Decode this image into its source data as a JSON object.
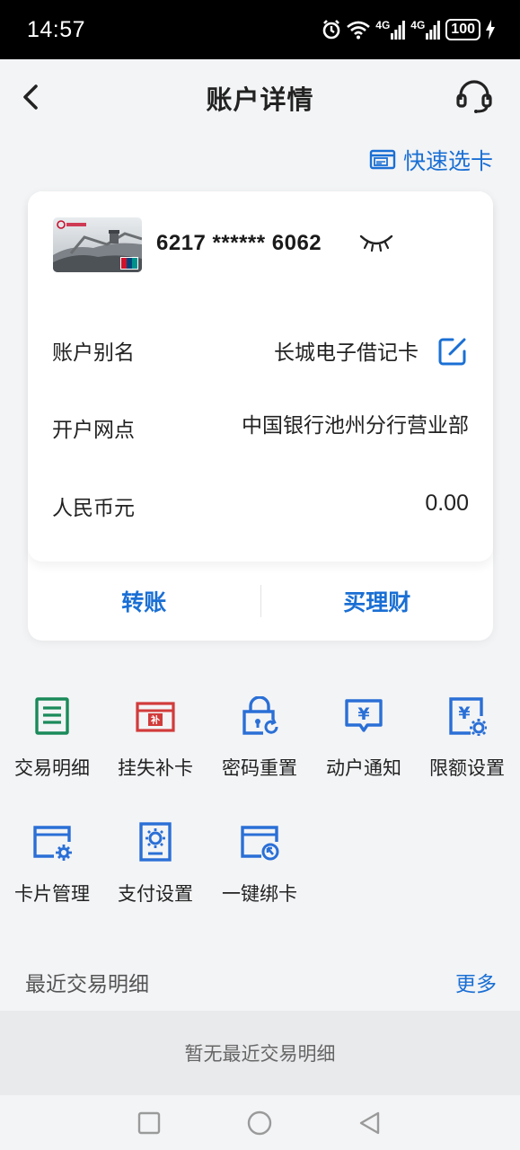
{
  "status_bar": {
    "time": "14:57",
    "network_1": "4G",
    "network_2": "4G",
    "battery": "100",
    "icons": [
      "alarm-icon",
      "wifi-icon",
      "signal-4g-icon",
      "signal-4g-icon",
      "battery-icon",
      "charging-icon"
    ]
  },
  "header": {
    "title": "账户详情",
    "back_icon": "back-arrow-icon",
    "service_icon": "headset-icon"
  },
  "quick_select": {
    "label": "快速选卡",
    "icon": "card-select-icon"
  },
  "account_card": {
    "card_number": "6217 ****** 6062",
    "eye_icon": "eye-closed-icon",
    "alias_label": "账户别名",
    "alias_value": "长城电子借记卡",
    "branch_label": "开户网点",
    "branch_value": "中国银行池州分行营业部",
    "currency_label": "人民币元",
    "balance": "0.00",
    "actions": {
      "transfer": "转账",
      "buy_wealth": "买理财"
    }
  },
  "services": [
    {
      "label": "交易明细",
      "icon": "transaction-list-icon",
      "color": "#1a8a5a"
    },
    {
      "label": "挂失补卡",
      "icon": "report-loss-icon",
      "color": "#d23b3b"
    },
    {
      "label": "密码重置",
      "icon": "password-lock-icon",
      "color": "#2a6fd6"
    },
    {
      "label": "动户通知",
      "icon": "notification-yuan-icon",
      "color": "#2a6fd6"
    },
    {
      "label": "限额设置",
      "icon": "limit-settings-icon",
      "color": "#2a6fd6"
    },
    {
      "label": "卡片管理",
      "icon": "card-manage-icon",
      "color": "#2a6fd6"
    },
    {
      "label": "支付设置",
      "icon": "payment-settings-icon",
      "color": "#2a6fd6"
    },
    {
      "label": "一键绑卡",
      "icon": "bind-card-icon",
      "color": "#2a6fd6"
    }
  ],
  "recent": {
    "title": "最近交易明细",
    "more": "更多",
    "empty": "暂无最近交易明细"
  },
  "colors": {
    "accent": "#1a6fd4",
    "background": "#f3f4f6"
  }
}
